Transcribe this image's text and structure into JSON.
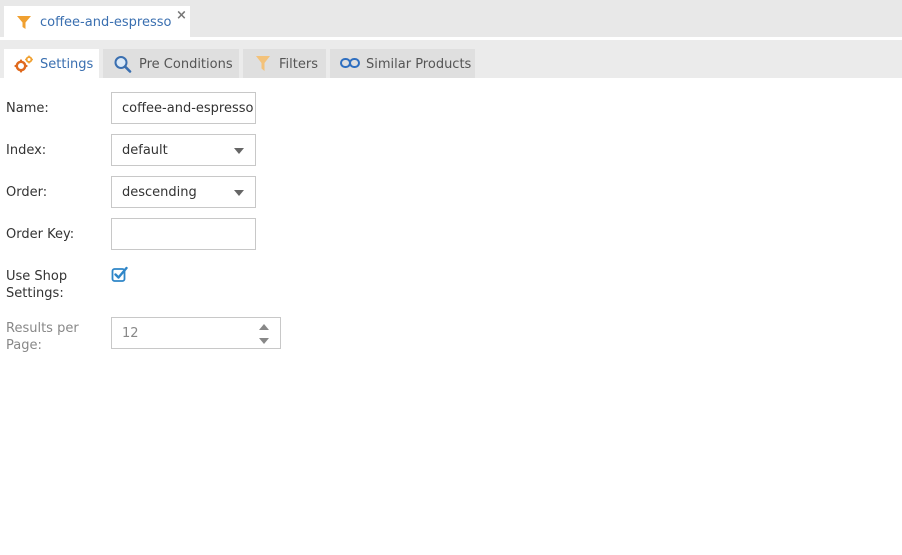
{
  "document_tab": {
    "title": "coffee-and-espresso",
    "close_glyph": "×",
    "icon": "funnel-icon",
    "icon_color": "#f0a030"
  },
  "tabs": [
    {
      "label": "Settings",
      "icon": "gears-icon",
      "active": true
    },
    {
      "label": "Pre Conditions",
      "icon": "magnifier-icon",
      "active": false
    },
    {
      "label": "Filters",
      "icon": "funnel-icon",
      "active": false
    },
    {
      "label": "Similar Products",
      "icon": "link-icon",
      "active": false
    }
  ],
  "form": {
    "name_label": "Name:",
    "name_value": "coffee-and-espresso",
    "index_label": "Index:",
    "index_value": "default",
    "order_label": "Order:",
    "order_value": "descending",
    "order_key_label": "Order Key:",
    "order_key_value": "",
    "use_shop_settings_label_line1": "Use Shop",
    "use_shop_settings_label_line2": "Settings:",
    "use_shop_settings_checked": true,
    "results_per_page_label_line1": "Results per",
    "results_per_page_label_line2": "Page:",
    "results_per_page_value": "12"
  },
  "colors": {
    "accent_blue": "#3a6fb0",
    "checkbox_blue": "#2f86c8",
    "orange": "#f0a030"
  }
}
